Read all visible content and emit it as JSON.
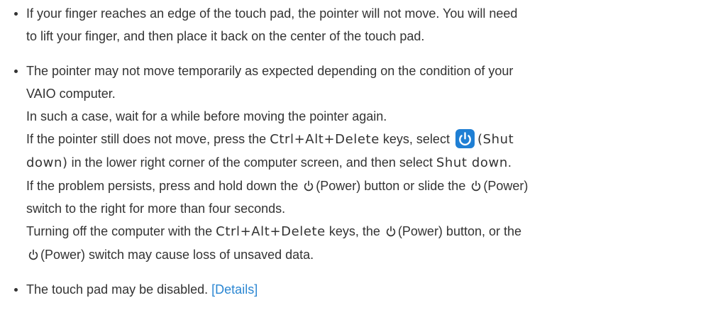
{
  "bullets": [
    {
      "lines": [
        "If your finger reaches an edge of the touch pad, the pointer will not move. You will need",
        "to lift your finger, and then place it back on the center of the touch pad."
      ]
    },
    {
      "line1": "The pointer may not move temporarily as expected depending on the condition of your",
      "line2": "VAIO computer.",
      "line3": "In such a case, wait for a while before moving the pointer again.",
      "line4_a": "If the pointer still does not move, press the ",
      "line4_key": "Ctrl+Alt+Delete",
      "line4_b": " keys, select ",
      "line4_c": "(Shut",
      "line5_a": "down)",
      "line5_b": " in the lower right corner of the computer screen, and then select ",
      "line5_c": "Shut down",
      "line5_d": ".",
      "line6_a": "If the problem persists, press and hold down the ",
      "line6_b": "(Power) button or slide the ",
      "line6_c": "(Power)",
      "line7": "switch to the right for more than four seconds.",
      "line8_a": "Turning off the computer with the ",
      "line8_key": "Ctrl+Alt+Delete",
      "line8_b": " keys, the ",
      "line8_c": "(Power) button, or the",
      "line9": "(Power) switch may cause loss of unsaved data."
    },
    {
      "text": "The touch pad may be disabled. ",
      "link": "[Details]"
    }
  ],
  "icons": {
    "power": "power-icon",
    "shutdown": "shutdown-icon",
    "shutdown_bg": "#1f7fd4"
  }
}
